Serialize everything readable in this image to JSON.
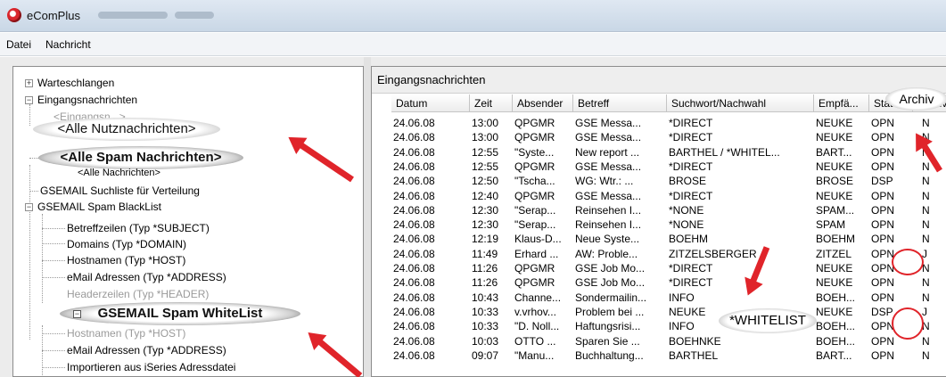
{
  "window": {
    "title": "eComPlus"
  },
  "menu": [
    "Datei",
    "Nachricht"
  ],
  "tree": {
    "warteschlangen": "Warteschlangen",
    "eingang": "Eingangsnachrichten",
    "alle_nutz_faded": "<Eingangsn...>",
    "alle_nutz": "<Alle Nutznachrichten>",
    "alle_spam": "<Alle Spam Nachrichten>",
    "alle_nachrichten": "<Alle Nachrichten>",
    "suchliste": "GSEMAIL Suchliste für Verteilung",
    "blacklist": "GSEMAIL Spam BlackList",
    "bl_items": [
      "Betreffzeilen (Typ *SUBJECT)",
      "Domains (Typ *DOMAIN)",
      "Hostnamen (Typ *HOST)",
      "eMail Adressen (Typ *ADDRESS)",
      "Headerzeilen (Typ *HEADER)"
    ],
    "whitelist": "GSEMAIL Spam WhiteList",
    "wl_items": [
      "Hostnamen (Typ *HOST)",
      "eMail Adressen (Typ *ADDRESS)",
      "Importieren aus iSeries Adressdatei"
    ]
  },
  "messages": {
    "caption": "Eingangsnachrichten",
    "columns": [
      "Datum",
      "Zeit",
      "Absender",
      "Betreff",
      "Suchwort/Nachwahl",
      "Empfä...",
      "Status",
      "Archiv"
    ],
    "rows": [
      [
        "24.06.08",
        "13:00",
        "QPGMR",
        "GSE Messa...",
        "*DIRECT",
        "NEUKE",
        "OPN",
        "N"
      ],
      [
        "24.06.08",
        "13:00",
        "QPGMR",
        "GSE Messa...",
        "*DIRECT",
        "NEUKE",
        "OPN",
        "N"
      ],
      [
        "24.06.08",
        "12:55",
        "\"Syste...",
        "New report ...",
        "BARTHEL / *WHITEL...",
        "BART...",
        "OPN",
        "N"
      ],
      [
        "24.06.08",
        "12:55",
        "QPGMR",
        "GSE Messa...",
        "*DIRECT",
        "NEUKE",
        "OPN",
        "N"
      ],
      [
        "24.06.08",
        "12:50",
        "\"Tscha...",
        "WG: Wtr.: ...",
        "BROSE",
        "BROSE",
        "DSP",
        "N"
      ],
      [
        "24.06.08",
        "12:40",
        "QPGMR",
        "GSE Messa...",
        "*DIRECT",
        "NEUKE",
        "OPN",
        "N"
      ],
      [
        "24.06.08",
        "12:30",
        "\"Serap...",
        "Reinsehen I...",
        "*NONE",
        "SPAM...",
        "OPN",
        "N"
      ],
      [
        "24.06.08",
        "12:30",
        "\"Serap...",
        "Reinsehen I...",
        "*NONE",
        "SPAM",
        "OPN",
        "N"
      ],
      [
        "24.06.08",
        "12:19",
        "Klaus-D...",
        "Neue Syste...",
        "BOEHM",
        "BOEHM",
        "OPN",
        "N"
      ],
      [
        "24.06.08",
        "11:49",
        "Erhard ...",
        "AW: Proble...",
        "ZITZELSBERGER",
        "ZITZEL",
        "OPN",
        "J"
      ],
      [
        "24.06.08",
        "11:26",
        "QPGMR",
        "GSE Job Mo...",
        "*DIRECT",
        "NEUKE",
        "OPN",
        "N"
      ],
      [
        "24.06.08",
        "11:26",
        "QPGMR",
        "GSE Job Mo...",
        "*DIRECT",
        "NEUKE",
        "OPN",
        "N"
      ],
      [
        "24.06.08",
        "10:43",
        "Channe...",
        "Sondermailin...",
        "INFO",
        "BOEH...",
        "OPN",
        "N"
      ],
      [
        "24.06.08",
        "10:33",
        "v.vrhov...",
        "Problem bei ...",
        "NEUKE",
        "NEUKE",
        "DSP",
        "J"
      ],
      [
        "24.06.08",
        "10:33",
        "\"D. Noll...",
        "Haftungsrisi...",
        "INFO",
        "BOEH...",
        "OPN",
        "N"
      ],
      [
        "24.06.08",
        "10:03",
        "OTTO ...",
        "Sparen Sie ...",
        "BOEHNKE",
        "BOEH...",
        "OPN",
        "N"
      ],
      [
        "24.06.08",
        "09:07",
        "\"Manu...",
        "Buchhaltung...",
        "BARTHEL",
        "BART...",
        "OPN",
        "N"
      ]
    ],
    "whitelist_callout": "*WHITELIST",
    "archiv_callout": "Archiv"
  },
  "colors": {
    "annotation": "#e0242a"
  }
}
